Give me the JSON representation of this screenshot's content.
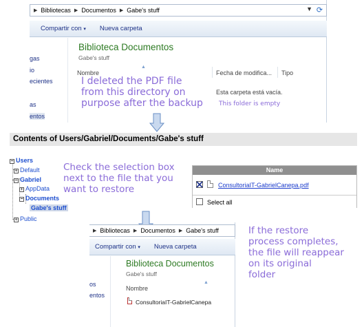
{
  "window1": {
    "breadcrumb": [
      "Bibliotecas",
      "Documentos",
      "Gabe's stuff"
    ],
    "toolbar": {
      "share": "Compartir con",
      "share_arrow": "▾",
      "new_folder": "Nueva carpeta"
    },
    "nav_items": [
      "gas",
      "io",
      "ecientes",
      "as",
      "entos"
    ],
    "library_title": "Biblioteca Documentos",
    "library_sub": "Gabe's stuff",
    "columns": {
      "name": "Nombre",
      "date": "Fecha de modifica...",
      "type": "Tipo"
    },
    "empty_text": "Esta carpeta está vacía.",
    "annotation_empty": "This folder is empty",
    "note": [
      "I deleted the PDF file",
      "from this directory on",
      "purpose after the backup"
    ]
  },
  "contents": {
    "title": "Contents of Users/Gabriel/Documents/Gabe's stuff",
    "tree": {
      "users": "Users",
      "default": "Default",
      "gabriel": "Gabriel",
      "appdata": "AppData",
      "documents": "Documents",
      "gabes_stuff": "Gabe's stuff",
      "public": "Public",
      "expand_glyph": "+",
      "collapse_glyph": "−"
    },
    "note": [
      "Check the selection box",
      "next to the file that you",
      "want to restore"
    ],
    "grid": {
      "header": "Name",
      "file": "ConsultoriaIT-GabrielCanepa.pdf",
      "file_checked": true,
      "select_all": "Select all"
    }
  },
  "window2": {
    "breadcrumb": [
      "Bibliotecas",
      "Documentos",
      "Gabe's stuff"
    ],
    "toolbar": {
      "share": "Compartir con",
      "share_arrow": "▾",
      "new_folder": "Nueva carpeta"
    },
    "nav_items": [
      "os",
      "entos"
    ],
    "library_title": "Biblioteca Documentos",
    "library_sub": "Gabe's stuff",
    "column_name": "Nombre",
    "file": "ConsultoriaIT-GabrielCanepa",
    "note": [
      "If the restore",
      "process completes,",
      "the file will reappear",
      "on its original",
      "folder"
    ]
  },
  "icons": {
    "breadcrumb_sep": "▶",
    "dropdown": "▼",
    "refresh": "⟳",
    "sort_up": "▲",
    "checked": "✕"
  },
  "colors": {
    "annotation": "#8a6bd8",
    "library_title": "#2d7a23",
    "link": "#1a3bcc",
    "tree_link": "#1e4fcf"
  }
}
